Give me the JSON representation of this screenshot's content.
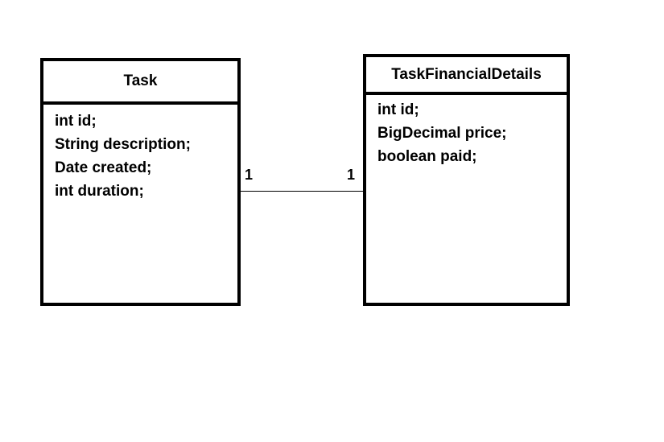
{
  "classes": [
    {
      "name": "Task",
      "attributes": [
        "int id;",
        "String description;",
        "Date created;",
        "int duration;"
      ]
    },
    {
      "name": "TaskFinancialDetails",
      "attributes": [
        "int id;",
        "BigDecimal price;",
        "boolean paid;"
      ]
    }
  ],
  "association": {
    "source_multiplicity": "1",
    "target_multiplicity": "1"
  }
}
